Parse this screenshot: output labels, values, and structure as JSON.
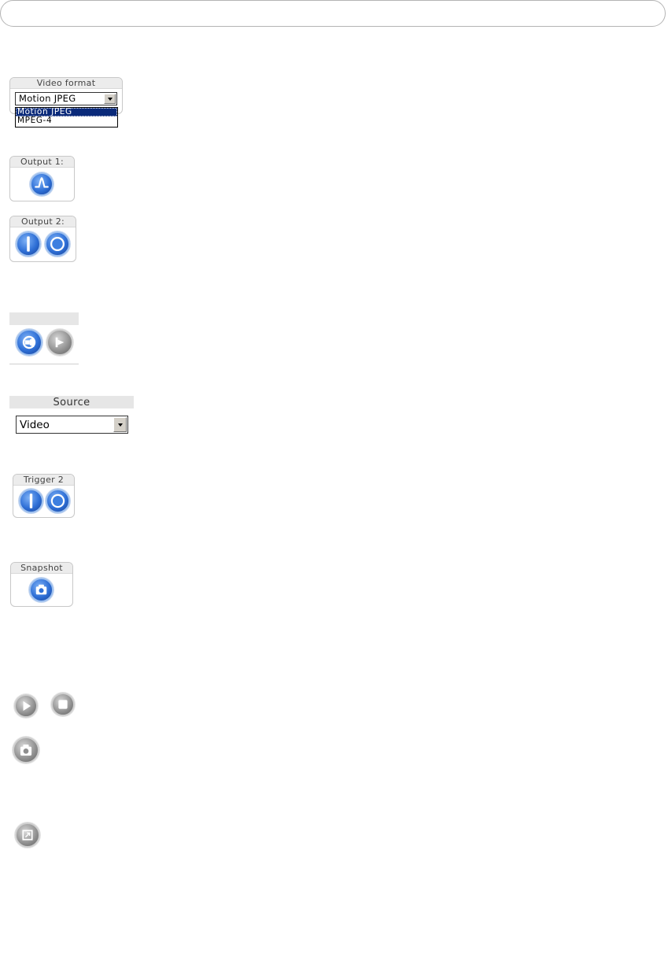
{
  "video_format": {
    "title": "Video format",
    "selected": "Motion JPEG",
    "options": [
      "Motion JPEG",
      "MPEG-4"
    ]
  },
  "output1": {
    "title": "Output 1:"
  },
  "output2": {
    "title": "Output 2:"
  },
  "source": {
    "title": "Source",
    "selected": "Video"
  },
  "trigger2": {
    "title": "Trigger 2"
  },
  "snapshot": {
    "title": "Snapshot"
  },
  "icons": {
    "output1_pulse": "pulse-icon",
    "output2_on": "on-icon",
    "output2_off": "off-icon",
    "audio_talk": "talk-icon",
    "audio_listen": "listen-icon",
    "trigger_on": "on-icon",
    "trigger_off": "off-icon",
    "snapshot": "camera-icon",
    "play": "play-icon",
    "stop": "stop-icon",
    "snapshot_gray": "camera-icon",
    "fullscreen": "fullscreen-icon"
  },
  "colors": {
    "button_blue": "#2e6fd6",
    "button_gray": "#8e8e8e",
    "selection_navy": "#0a2a7a"
  }
}
